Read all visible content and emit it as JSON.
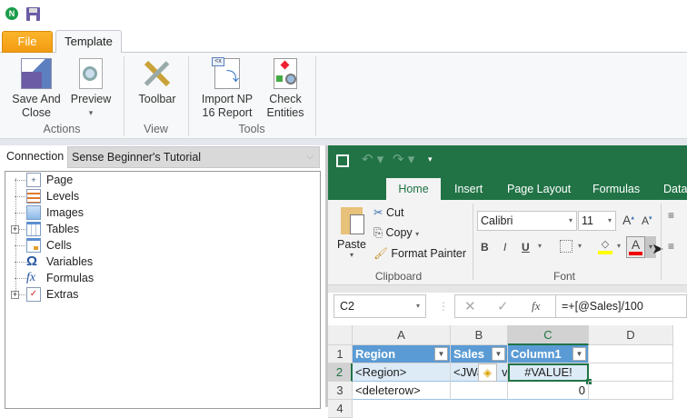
{
  "app": {
    "logo_letter": "N"
  },
  "tabs": {
    "file": "File",
    "template": "Template"
  },
  "ribbon": {
    "buttons": [
      {
        "label1": "Save And",
        "label2": "Close"
      },
      {
        "label1": "Preview",
        "label2": "▾"
      },
      {
        "label1": "Toolbar",
        "label2": ""
      },
      {
        "label1": "Import NP",
        "label2": "16 Report"
      },
      {
        "label1": "Check",
        "label2": "Entities"
      }
    ],
    "groups": [
      "Actions",
      "View",
      "Tools"
    ]
  },
  "connection": {
    "label": "Connection",
    "value": "Sense Beginner's Tutorial"
  },
  "tree": [
    {
      "label": "Page",
      "expandable": false
    },
    {
      "label": "Levels",
      "expandable": false
    },
    {
      "label": "Images",
      "expandable": false
    },
    {
      "label": "Tables",
      "expandable": true
    },
    {
      "label": "Cells",
      "expandable": false
    },
    {
      "label": "Variables",
      "expandable": false
    },
    {
      "label": "Formulas",
      "expandable": false
    },
    {
      "label": "Extras",
      "expandable": true
    }
  ],
  "excel": {
    "tabs": [
      "Home",
      "Insert",
      "Page Layout",
      "Formulas",
      "Data"
    ],
    "clipboard": {
      "paste": "Paste",
      "cut": "Cut",
      "copy": "Copy",
      "format_painter": "Format Painter",
      "group": "Clipboard"
    },
    "font": {
      "name": "Calibri",
      "size": "11",
      "group": "Font",
      "bold": "B",
      "italic": "I",
      "underline": "U",
      "font_color": "A"
    },
    "namebox": "C2",
    "fx": "fx",
    "formula": "=+[@Sales]/100",
    "columns": [
      "A",
      "B",
      "C",
      "D"
    ],
    "rows": [
      "1",
      "2",
      "3",
      "4"
    ],
    "cells": {
      "A1": "Region",
      "B1": "Sales",
      "C1": "Column1",
      "A2": "<Region>",
      "B2": "<JWa",
      "B2b": "v>",
      "C2": "#VALUE!",
      "A3": "<deleterow>",
      "C3": "0"
    }
  },
  "colors": {
    "excel_green": "#217346",
    "table_header": "#5b9bd5",
    "file_tab": "#f5a623"
  }
}
